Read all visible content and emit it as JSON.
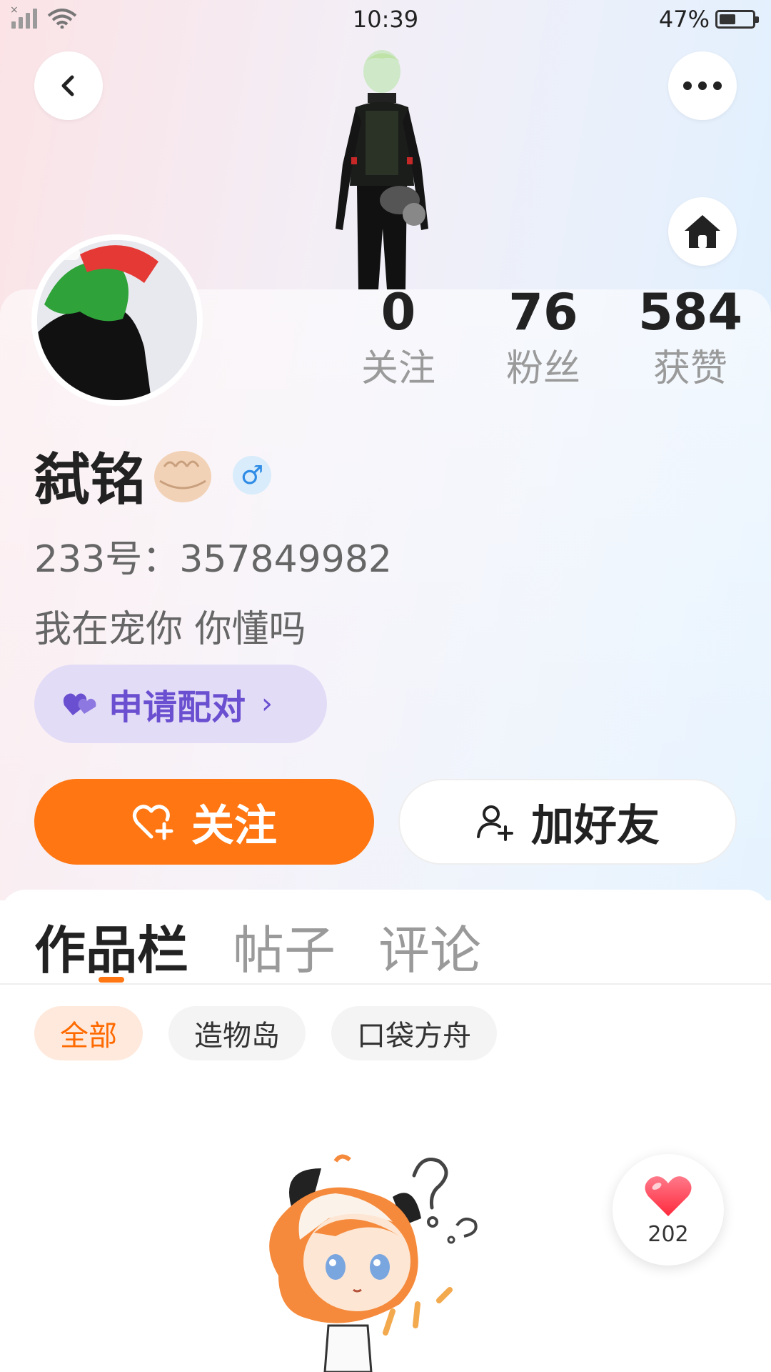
{
  "status_bar": {
    "time": "10:39",
    "battery_percent": "47%",
    "battery_level": 0.47,
    "icons": [
      "no-sim-signal-icon",
      "wifi-icon",
      "battery-icon"
    ]
  },
  "header": {
    "icons": [
      "back-arrow-icon",
      "more-dots-icon",
      "home-icon"
    ]
  },
  "profile": {
    "stats": [
      {
        "value": "0",
        "label": "关注"
      },
      {
        "value": "76",
        "label": "粉丝"
      },
      {
        "value": "584",
        "label": "获赞"
      }
    ],
    "username": "弑铭",
    "username_emoji": "fist-emoji",
    "gender_symbol": "♂",
    "id_text": "233号：357849982",
    "bio": "我在宠你 你懂吗",
    "pair_button": {
      "label": "申请配对",
      "chevron": "›",
      "icon": "double-heart-icon"
    }
  },
  "actions": {
    "follow_label": "关注",
    "add_friend_label": "加好友",
    "icons": [
      "heart-plus-icon",
      "user-plus-icon"
    ]
  },
  "tabs": [
    {
      "label": "作品栏",
      "active": true
    },
    {
      "label": "帖子",
      "active": false
    },
    {
      "label": "评论",
      "active": false
    }
  ],
  "filters": [
    {
      "label": "全部",
      "active": true
    },
    {
      "label": "造物岛",
      "active": false
    },
    {
      "label": "口袋方舟",
      "active": false
    }
  ],
  "like_float": {
    "count": "202",
    "icon": "heart-icon"
  },
  "colors": {
    "accent": "#ff7612",
    "pair_bg": "#e3dcf7",
    "pair_text": "#6a4fd0",
    "gender_blue": "#2f8ce6"
  }
}
